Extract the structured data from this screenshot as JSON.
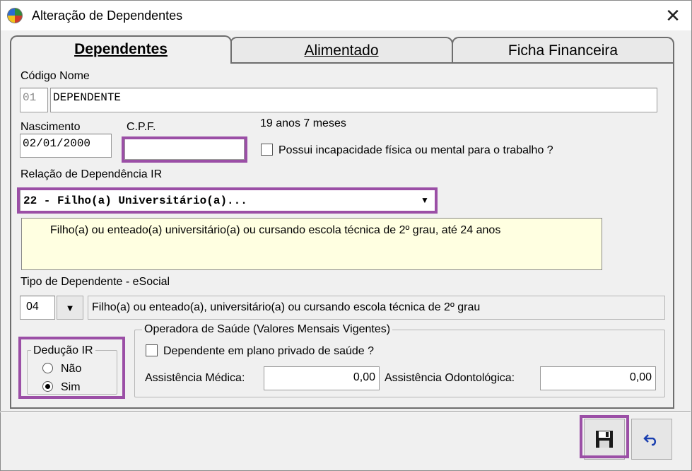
{
  "window": {
    "title": "Alteração de Dependentes",
    "close_glyph": "✕",
    "icon": "app-globe-icon"
  },
  "tabs": [
    {
      "label": "Dependentes",
      "active": true
    },
    {
      "label": "Alimentado",
      "active": false
    },
    {
      "label": "Ficha Financeira",
      "active": false
    }
  ],
  "form": {
    "codigo_nome_label": "Código Nome",
    "codigo_value": "01",
    "nome_value": "DEPENDENTE",
    "nascimento_label": "Nascimento",
    "nascimento_value": "02/01/2000",
    "cpf_label": "C.P.F.",
    "cpf_value": "",
    "idade_text": "19 anos 7 meses",
    "incapacidade_label": "Possui incapacidade física ou mental para o trabalho ?",
    "relacao_label": "Relação de Dependência IR",
    "relacao_value": "22 - Filho(a) Universitário(a)...",
    "relacao_description": "Filho(a) ou enteado(a) universitário(a) ou cursando escola técnica de 2º grau, até 24 anos",
    "tipo_label": "Tipo de Dependente - eSocial",
    "tipo_code": "04",
    "tipo_description": "Filho(a) ou enteado(a), universitário(a) ou cursando escola técnica de 2º grau"
  },
  "deducao": {
    "title": "Dedução IR",
    "options": [
      {
        "label": "Não",
        "selected": false
      },
      {
        "label": "Sim",
        "selected": true
      }
    ]
  },
  "saude": {
    "title": "Operadora de Saúde (Valores Mensais Vigentes)",
    "plano_label": "Dependente em plano privado de saúde ?",
    "medica_label": "Assistência Médica:",
    "medica_value": "0,00",
    "odonto_label": "Assistência Odontológica:",
    "odonto_value": "0,00"
  },
  "buttons": {
    "save_icon": "floppy-disk-icon",
    "undo_icon": "undo-icon"
  },
  "colors": {
    "highlight": "#9b4fa6",
    "memo_background": "#ffffe1"
  }
}
